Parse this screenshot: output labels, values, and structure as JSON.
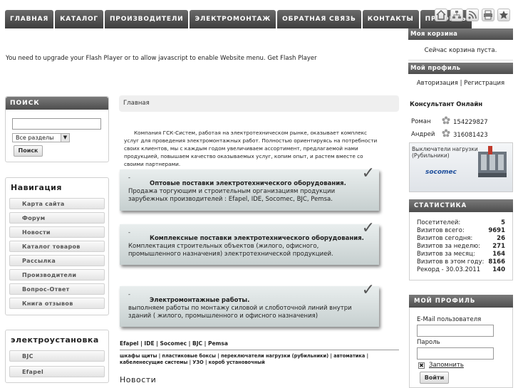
{
  "nav": {
    "tabs": [
      "ГЛАВНАЯ",
      "КАТАЛОГ",
      "ПРОИЗВОДИТЕЛИ",
      "ЭЛЕКТРОМОНТАЖ",
      "ОБРАТНАЯ СВЯЗЬ",
      "КОНТАКТЫ",
      "ПРОФИЛЬ"
    ],
    "icons": [
      "home-icon",
      "sitemap-icon",
      "rss-icon",
      "print-icon",
      "star-icon"
    ]
  },
  "flash_message": "You need to upgrade your Flash Player or to allow javascript to enable Website menu. Get Flash Player",
  "cart": {
    "title": "Моя корзина",
    "status": "Сейчас корзина пуста."
  },
  "profile_top": {
    "title": "Мой профиль",
    "login_link": "Авторизация",
    "separator": "|",
    "register_link": "Регистрация"
  },
  "consultants": {
    "title": "Консультант Онлайн",
    "items": [
      {
        "name": "Роман",
        "icq": "154229827"
      },
      {
        "name": "Андрей",
        "icq": "316081423"
      }
    ]
  },
  "banner": {
    "line1": "Выключатели нагрузки",
    "line2": "(Рубильники)",
    "brand": "socomec"
  },
  "stats": {
    "title": "СТАТИСТИКА",
    "rows": [
      {
        "label": "Посетителей:",
        "value": "5"
      },
      {
        "label": "Визитов всего:",
        "value": "9691"
      },
      {
        "label": "Визитов сегодня:",
        "value": "26"
      },
      {
        "label": "Визитов за неделю:",
        "value": "271"
      },
      {
        "label": "Визитов за месяц:",
        "value": "164"
      },
      {
        "label": "Визитов в этом году:",
        "value": "8166"
      },
      {
        "label": "Рекорд - 30.03.2011",
        "value": "140"
      }
    ]
  },
  "profile_box": {
    "title": "МОЙ ПРОФИЛЬ",
    "email_label": "E-Mail пользователя",
    "password_label": "Пароль",
    "remember_label": "Запомнить",
    "login_button": "Войти"
  },
  "search": {
    "title": "ПОИСК",
    "section_value": "Все разделы",
    "button": "Поиск"
  },
  "navigation": {
    "title": "Навигация",
    "items": [
      "Карта сайта",
      "Форум",
      "Новости",
      "Каталог товаров",
      "Рассылка",
      "Производители",
      "Вопрос-Ответ",
      "Книга отзывов"
    ]
  },
  "electro": {
    "title": "электроустановка",
    "items": [
      "BJC",
      "Efapel"
    ]
  },
  "breadcrumb": "Главная",
  "intro_text": "Компания ГСК-Систем, работая на электротехническом рынке, оказывает комплекс услуг для проведения электромонтажных работ. Полностью ориентируясь на потребности своих клиентов, мы с каждым годом увеличиваем ассортимент, предлагаемой нами продукцией, повышаем качество оказываемых услуг, копим опыт, и растем вместе со своими партнерами.",
  "promos": [
    {
      "title": "Оптовые поставки электротехнического оборудования.",
      "text": "Продажа торгующим и строительным организациям продукции зарубежных производителей : Efapel, IDE, Socomec, BJC, Pemsa."
    },
    {
      "title": "Комплексные поставки электротехнического оборудования.",
      "text": "Комплектация строительных объектов (жилого, офисного, промышленного назначения) электротехнической продукцией."
    },
    {
      "title": "Электромонтажные работы.",
      "text": "выполняем работы по монтажу силовой и слоботочной линий внутри зданий ( жилого, промышленного и офисного назначения)"
    }
  ],
  "brand_line": "Efapel | IDE | Socomec | BJC | Pemsa",
  "category_line": "шкафы щиты | пластиковые боксы | переключатели нагрузки (рубильники) | автоматика | кабеленесущие системы | УЗО | короб установочный",
  "news_title": "Новости"
}
